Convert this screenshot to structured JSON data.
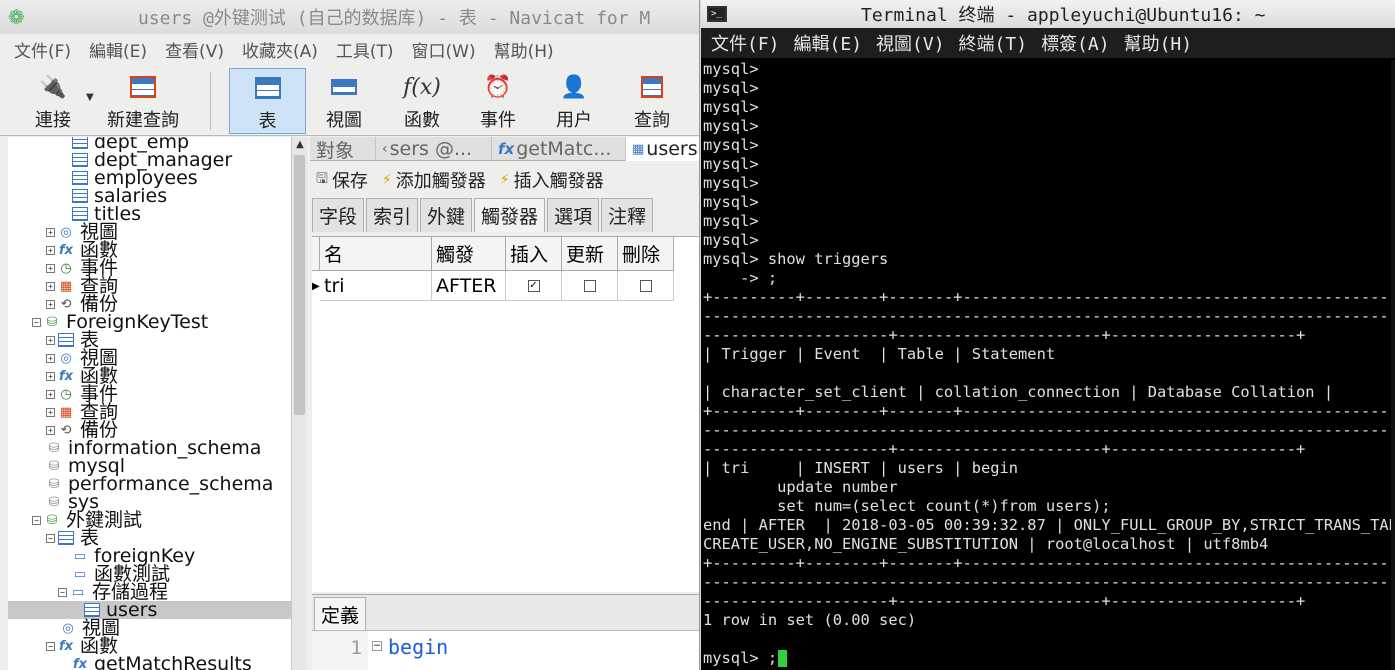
{
  "navicat": {
    "title": "users @外键测试 (自己的数据库) - 表 - Navicat for M",
    "menu": [
      "文件(F)",
      "編輯(E)",
      "查看(V)",
      "收藏夾(A)",
      "工具(T)",
      "窗口(W)",
      "幫助(H)"
    ],
    "toolbar": {
      "connect": "連接",
      "new_query": "新建查詢",
      "table": "表",
      "view": "視圖",
      "function": "函數",
      "event": "事件",
      "user": "用户",
      "query": "查詢"
    },
    "tree": [
      {
        "label": "dept_emp",
        "icon": "table-icon"
      },
      {
        "label": "dept_manager",
        "icon": "table-icon"
      },
      {
        "label": "employees",
        "icon": "table-icon"
      },
      {
        "label": "salaries",
        "icon": "table-icon"
      },
      {
        "label": "titles",
        "icon": "table-icon"
      },
      {
        "label": "視圖",
        "icon": "view-icon"
      },
      {
        "label": "函數",
        "icon": "function-icon"
      },
      {
        "label": "事件",
        "icon": "event-icon"
      },
      {
        "label": "查詢",
        "icon": "query-icon"
      },
      {
        "label": "備份",
        "icon": "backup-icon"
      },
      {
        "label": "ForeignKeyTest",
        "icon": "database-icon"
      },
      {
        "label": "表",
        "icon": "table-icon"
      },
      {
        "label": "視圖",
        "icon": "view-icon"
      },
      {
        "label": "函數",
        "icon": "function-icon"
      },
      {
        "label": "事件",
        "icon": "event-icon"
      },
      {
        "label": "查詢",
        "icon": "query-icon"
      },
      {
        "label": "備份",
        "icon": "backup-icon"
      },
      {
        "label": "information_schema",
        "icon": "database-icon"
      },
      {
        "label": "mysql",
        "icon": "database-icon"
      },
      {
        "label": "performance_schema",
        "icon": "database-icon"
      },
      {
        "label": "sys",
        "icon": "database-icon"
      },
      {
        "label": "外鍵測試",
        "icon": "database-icon"
      },
      {
        "label": "表",
        "icon": "table-icon"
      },
      {
        "label": "foreignKey",
        "icon": "folder-icon"
      },
      {
        "label": "函數測試",
        "icon": "folder-icon"
      },
      {
        "label": "存儲過程",
        "icon": "folder-icon"
      },
      {
        "label": "users",
        "icon": "table-icon"
      },
      {
        "label": "視圖",
        "icon": "view-icon"
      },
      {
        "label": "函數",
        "icon": "function-icon"
      },
      {
        "label": "getMatchResults",
        "icon": "function-icon"
      }
    ],
    "tabs": [
      "對象",
      "sers @...",
      "getMatc...",
      "users"
    ],
    "actions": {
      "save": "保存",
      "add_trigger": "添加觸發器",
      "insert_trigger": "插入觸發器"
    },
    "subtabs": [
      "字段",
      "索引",
      "外鍵",
      "觸發器",
      "選項",
      "注釋"
    ],
    "grid": {
      "columns": [
        "名",
        "觸發",
        "插入",
        "更新",
        "刪除"
      ],
      "rows": [
        {
          "name": "tri",
          "timing": "AFTER",
          "insert": true,
          "update": false,
          "delete": false
        }
      ]
    },
    "definition_tab": "定義",
    "editor": {
      "line_number": "1",
      "code": "begin"
    }
  },
  "terminal": {
    "title": "Terminal 终端 - appleyuchi@Ubuntu16: ~",
    "menu": [
      "文件(F)",
      "編輯(E)",
      "視圖(V)",
      "終端(T)",
      "標簽(A)",
      "幫助(H)"
    ],
    "lines": [
      "mysql>",
      "mysql>",
      "mysql>",
      "mysql>",
      "mysql>",
      "mysql>",
      "mysql>",
      "mysql>",
      "mysql>",
      "mysql>",
      "mysql> show triggers",
      "    -> ;",
      "+---------+--------+-------+-------------------------------------------------------",
      "-----------------------------------------------------------------------------------",
      "--------------------+----------------------+--------------------+",
      "| Trigger | Event  | Table | Statement",
      "",
      "| character_set_client | collation_connection | Database Collation |",
      "+---------+--------+-------+-------------------------------------------------------",
      "-----------------------------------------------------------------------------------",
      "--------------------+----------------------+--------------------+",
      "| tri     | INSERT | users | begin",
      "        update number",
      "        set num=(select count(*)from users);",
      "end | AFTER  | 2018-03-05 00:39:32.87 | ONLY_FULL_GROUP_BY,STRICT_TRANS_TABLES",
      "CREATE_USER,NO_ENGINE_SUBSTITUTION | root@localhost | utf8mb4",
      "+---------+--------+-------+-------------------------------------------------------",
      "-----------------------------------------------------------------------------------",
      "--------------------+----------------------+--------------------+",
      "1 row in set (0.00 sec)",
      "",
      "mysql> ;"
    ]
  }
}
